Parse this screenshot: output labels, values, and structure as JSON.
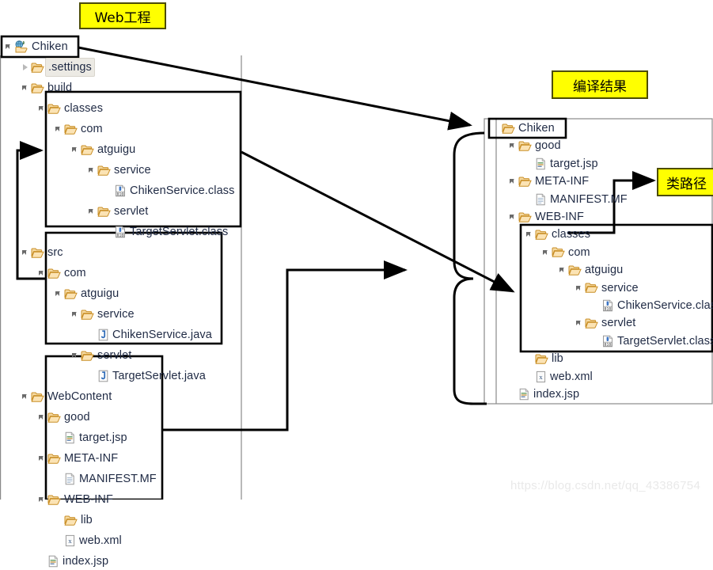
{
  "annotations": {
    "web_project": "Web工程",
    "compile_result": "编译结果",
    "class_path": "类路径"
  },
  "watermark": "https://blog.csdn.net/qq_43386754",
  "left_tree": {
    "title": "Chiken",
    "nodes": [
      {
        "label": "Chiken",
        "icon": "java-project-icon",
        "depth": 0,
        "toggle": "open",
        "selected": false,
        "boxed": true
      },
      {
        "label": ".settings",
        "icon": "folder-icon",
        "depth": 1,
        "toggle": "closed",
        "selected": true,
        "boxed": false
      },
      {
        "label": "build",
        "icon": "folder-icon",
        "depth": 1,
        "toggle": "open",
        "selected": false,
        "boxed": false
      },
      {
        "label": "classes",
        "icon": "folder-icon",
        "depth": 2,
        "toggle": "open",
        "selected": false,
        "boxed": false
      },
      {
        "label": "com",
        "icon": "folder-icon",
        "depth": 3,
        "toggle": "open",
        "selected": false,
        "boxed": false
      },
      {
        "label": "atguigu",
        "icon": "folder-icon",
        "depth": 4,
        "toggle": "open",
        "selected": false,
        "boxed": false
      },
      {
        "label": "service",
        "icon": "folder-icon",
        "depth": 5,
        "toggle": "open",
        "selected": false,
        "boxed": false
      },
      {
        "label": "ChikenService.class",
        "icon": "class-file-icon",
        "depth": 6,
        "toggle": "none",
        "selected": false,
        "boxed": false
      },
      {
        "label": "servlet",
        "icon": "folder-icon",
        "depth": 5,
        "toggle": "open",
        "selected": false,
        "boxed": false
      },
      {
        "label": "TargetServlet.class",
        "icon": "class-file-icon",
        "depth": 6,
        "toggle": "none",
        "selected": false,
        "boxed": false
      },
      {
        "label": "src",
        "icon": "folder-icon",
        "depth": 1,
        "toggle": "open",
        "selected": false,
        "boxed": false
      },
      {
        "label": "com",
        "icon": "folder-icon",
        "depth": 2,
        "toggle": "open",
        "selected": false,
        "boxed": false
      },
      {
        "label": "atguigu",
        "icon": "folder-icon",
        "depth": 3,
        "toggle": "open",
        "selected": false,
        "boxed": false
      },
      {
        "label": "service",
        "icon": "folder-icon",
        "depth": 4,
        "toggle": "open",
        "selected": false,
        "boxed": false
      },
      {
        "label": "ChikenService.java",
        "icon": "java-file-icon",
        "depth": 5,
        "toggle": "none",
        "selected": false,
        "boxed": false
      },
      {
        "label": "servlet",
        "icon": "folder-icon",
        "depth": 4,
        "toggle": "open",
        "selected": false,
        "boxed": false
      },
      {
        "label": "TargetServlet.java",
        "icon": "java-file-icon",
        "depth": 5,
        "toggle": "none",
        "selected": false,
        "boxed": false
      },
      {
        "label": "WebContent",
        "icon": "folder-icon",
        "depth": 1,
        "toggle": "open",
        "selected": false,
        "boxed": false
      },
      {
        "label": "good",
        "icon": "folder-icon",
        "depth": 2,
        "toggle": "open",
        "selected": false,
        "boxed": false
      },
      {
        "label": "target.jsp",
        "icon": "jsp-file-icon",
        "depth": 3,
        "toggle": "none",
        "selected": false,
        "boxed": false
      },
      {
        "label": "META-INF",
        "icon": "folder-icon",
        "depth": 2,
        "toggle": "open",
        "selected": false,
        "boxed": false
      },
      {
        "label": "MANIFEST.MF",
        "icon": "text-file-icon",
        "depth": 3,
        "toggle": "none",
        "selected": false,
        "boxed": false
      },
      {
        "label": "WEB-INF",
        "icon": "folder-icon",
        "depth": 2,
        "toggle": "open",
        "selected": false,
        "boxed": false
      },
      {
        "label": "lib",
        "icon": "folder-icon",
        "depth": 3,
        "toggle": "none",
        "selected": false,
        "boxed": false
      },
      {
        "label": "web.xml",
        "icon": "xml-file-icon",
        "depth": 3,
        "toggle": "none",
        "selected": false,
        "boxed": false
      },
      {
        "label": "index.jsp",
        "icon": "jsp-file-icon",
        "depth": 2,
        "toggle": "none",
        "selected": false,
        "boxed": false
      }
    ]
  },
  "right_tree": {
    "title": "Chiken",
    "nodes": [
      {
        "label": "Chiken",
        "icon": "folder-icon",
        "depth": 0,
        "toggle": "none",
        "boxed": true
      },
      {
        "label": "good",
        "icon": "folder-icon",
        "depth": 1,
        "toggle": "open",
        "boxed": false
      },
      {
        "label": "target.jsp",
        "icon": "jsp-file-icon",
        "depth": 2,
        "toggle": "none",
        "boxed": false
      },
      {
        "label": "META-INF",
        "icon": "folder-icon",
        "depth": 1,
        "toggle": "open",
        "boxed": false
      },
      {
        "label": "MANIFEST.MF",
        "icon": "text-file-icon",
        "depth": 2,
        "toggle": "none",
        "boxed": false
      },
      {
        "label": "WEB-INF",
        "icon": "folder-icon",
        "depth": 1,
        "toggle": "open",
        "boxed": false
      },
      {
        "label": "classes",
        "icon": "folder-icon",
        "depth": 2,
        "toggle": "open",
        "boxed": true
      },
      {
        "label": "com",
        "icon": "folder-icon",
        "depth": 3,
        "toggle": "open",
        "boxed": false
      },
      {
        "label": "atguigu",
        "icon": "folder-icon",
        "depth": 4,
        "toggle": "open",
        "boxed": false
      },
      {
        "label": "service",
        "icon": "folder-icon",
        "depth": 5,
        "toggle": "open",
        "boxed": false
      },
      {
        "label": "ChikenService.class",
        "icon": "class-file-icon",
        "depth": 6,
        "toggle": "none",
        "boxed": false
      },
      {
        "label": "servlet",
        "icon": "folder-icon",
        "depth": 5,
        "toggle": "open",
        "boxed": false
      },
      {
        "label": "TargetServlet.class",
        "icon": "class-file-icon",
        "depth": 6,
        "toggle": "none",
        "boxed": false
      },
      {
        "label": "lib",
        "icon": "folder-icon",
        "depth": 2,
        "toggle": "none",
        "boxed": false
      },
      {
        "label": "web.xml",
        "icon": "xml-file-icon",
        "depth": 2,
        "toggle": "none",
        "boxed": false
      },
      {
        "label": "index.jsp",
        "icon": "jsp-file-icon",
        "depth": 1,
        "toggle": "none",
        "boxed": false
      }
    ]
  },
  "colors": {
    "highlight": "#ffff00",
    "highlight_border": "#4d4d00",
    "folder": "#f0b450",
    "text": "#1f2a44",
    "connector": "#000000",
    "frame": "#8a8a8a",
    "watermark": "#e9e9e9"
  }
}
